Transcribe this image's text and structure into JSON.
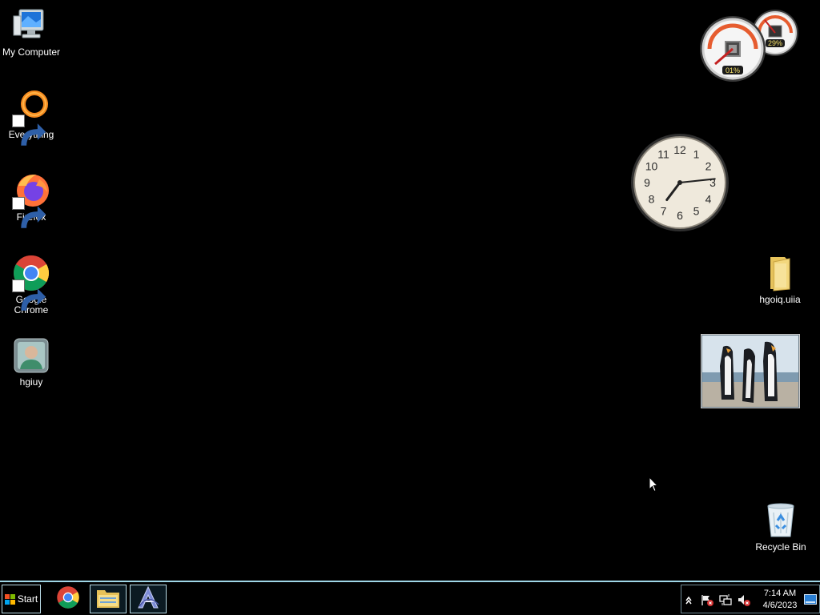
{
  "desktop": {
    "icons_left": [
      {
        "label": "My Computer",
        "icon": "computer-icon"
      },
      {
        "label": "Everything",
        "icon": "everything-search-icon"
      },
      {
        "label": "Firefox",
        "icon": "firefox-icon"
      },
      {
        "label": "Google Chrome",
        "icon": "chrome-icon"
      },
      {
        "label": "hgiuy",
        "icon": "user-contact-icon"
      }
    ],
    "icons_right": [
      {
        "label": "hgoiq.uiia",
        "icon": "folder-icon"
      },
      {
        "label": "Recycle Bin",
        "icon": "recycle-bin-icon"
      }
    ]
  },
  "gadgets": {
    "cpu_meter": {
      "cpu_label": "01%",
      "memory_label": "29%",
      "cpu_value": 1,
      "memory_value": 29
    },
    "clock": {
      "numerals": [
        "12",
        "1",
        "2",
        "3",
        "4",
        "5",
        "6",
        "7",
        "8",
        "9",
        "10",
        "11"
      ],
      "hour": 7,
      "minute": 14
    },
    "slideshow": {
      "image": "penguins-photo"
    }
  },
  "taskbar": {
    "start_label": "Start",
    "apps": [
      {
        "icon": "chrome-icon",
        "active": false
      },
      {
        "icon": "file-explorer-icon",
        "active": true
      },
      {
        "icon": "app-a-icon",
        "active": true
      }
    ],
    "tray": {
      "icons": [
        "show-hidden-icons-chevron",
        "action-center-flag-icon",
        "network-icon",
        "volume-muted-icon"
      ],
      "time": "7:14 AM",
      "date": "4/6/2023"
    }
  },
  "colors": {
    "desktop_bg": "#000000",
    "taskbar_accent": "#9fd6e6"
  }
}
